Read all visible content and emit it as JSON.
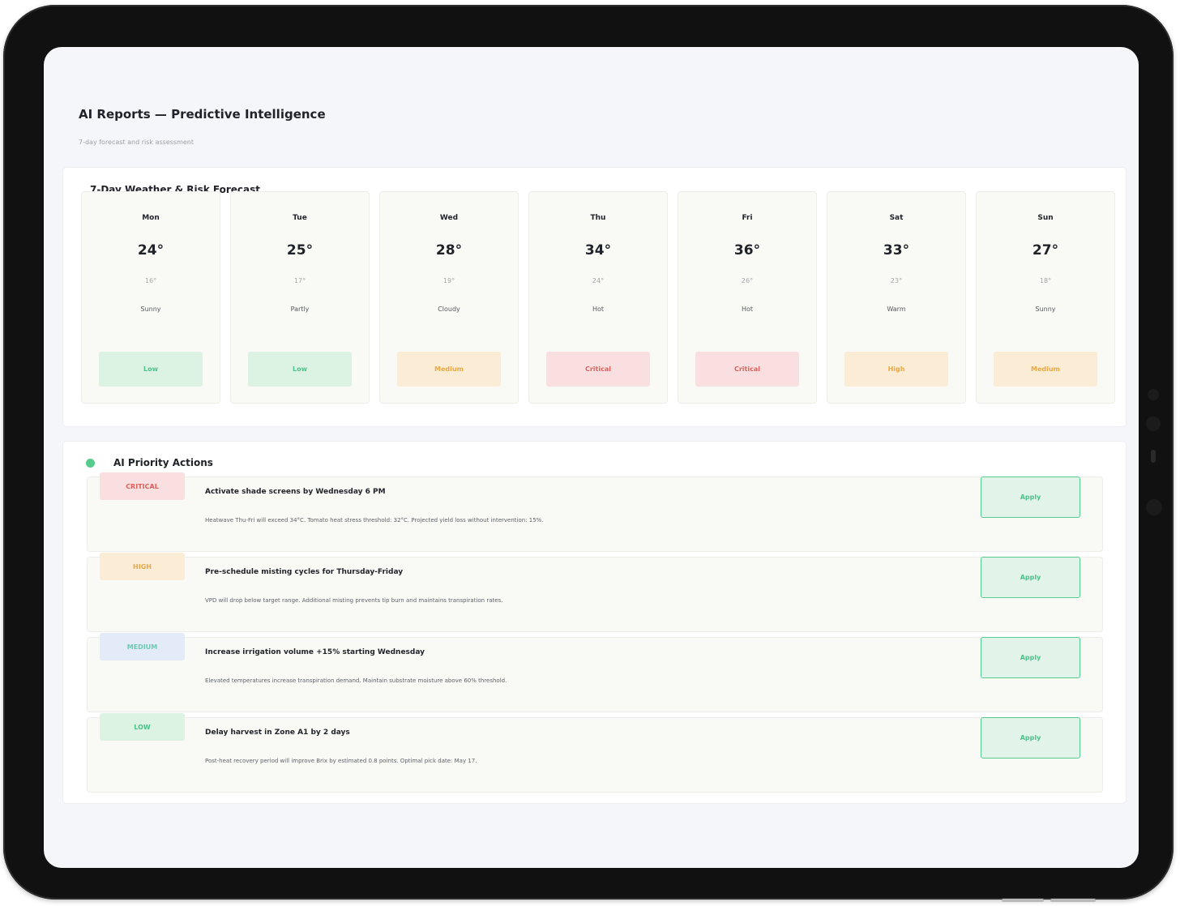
{
  "header": {
    "title": "AI Reports — Predictive Intelligence",
    "subtitle": "7-day forecast and risk assessment"
  },
  "forecast": {
    "title": "7-Day Weather & Risk Forecast",
    "days": [
      {
        "day": "Mon",
        "high": "24°",
        "low": "16°",
        "condition": "Sunny",
        "risk": "Low",
        "risk_level": "low"
      },
      {
        "day": "Tue",
        "high": "25°",
        "low": "17°",
        "condition": "Partly",
        "risk": "Low",
        "risk_level": "low"
      },
      {
        "day": "Wed",
        "high": "28°",
        "low": "19°",
        "condition": "Cloudy",
        "risk": "Medium",
        "risk_level": "medium"
      },
      {
        "day": "Thu",
        "high": "34°",
        "low": "24°",
        "condition": "Hot",
        "risk": "Critical",
        "risk_level": "critical"
      },
      {
        "day": "Fri",
        "high": "36°",
        "low": "26°",
        "condition": "Hot",
        "risk": "Critical",
        "risk_level": "critical"
      },
      {
        "day": "Sat",
        "high": "33°",
        "low": "23°",
        "condition": "Warm",
        "risk": "High",
        "risk_level": "high"
      },
      {
        "day": "Sun",
        "high": "27°",
        "low": "18°",
        "condition": "Sunny",
        "risk": "Medium",
        "risk_level": "medium"
      }
    ]
  },
  "actions": {
    "title": "AI Priority Actions",
    "apply_label": "Apply",
    "items": [
      {
        "priority": "CRITICAL",
        "priority_level": "critical",
        "title": "Activate shade screens by Wednesday 6 PM",
        "description": "Heatwave Thu-Fri will exceed 34°C. Tomato heat stress threshold: 32°C. Projected yield loss without intervention: 15%."
      },
      {
        "priority": "HIGH",
        "priority_level": "high",
        "title": "Pre-schedule misting cycles for Thursday-Friday",
        "description": "VPD will drop below target range. Additional misting prevents tip burn and maintains transpiration rates."
      },
      {
        "priority": "MEDIUM",
        "priority_level": "medium",
        "title": "Increase irrigation volume +15% starting Wednesday",
        "description": "Elevated temperatures increase transpiration demand. Maintain substrate moisture above 60% threshold."
      },
      {
        "priority": "LOW",
        "priority_level": "low",
        "title": "Delay harvest in Zone A1 by 2 days",
        "description": "Post-heat recovery period will improve Brix by estimated 0.8 points. Optimal pick date: May 17."
      }
    ]
  },
  "colors": {
    "accent_green": "#55cc8d",
    "critical_red": "#e0625e",
    "warning_orange": "#eaa845",
    "screen_bg": "#f5f6fa"
  }
}
